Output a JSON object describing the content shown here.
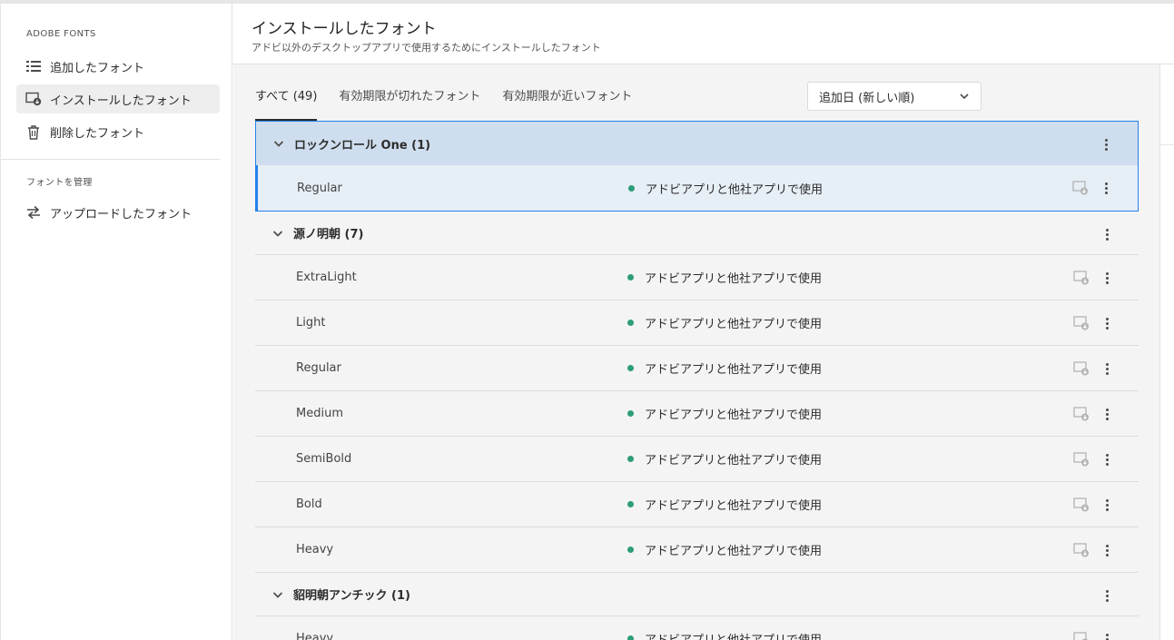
{
  "sidebar": {
    "section_fonts": "ADOBE FONTS",
    "items": [
      {
        "label": "追加したフォント",
        "icon": "list-icon"
      },
      {
        "label": "インストールしたフォント",
        "icon": "install-icon"
      },
      {
        "label": "削除したフォント",
        "icon": "trash-icon"
      }
    ],
    "section_manage": "フォントを管理",
    "manage_items": [
      {
        "label": "アップロードしたフォント",
        "icon": "upload-arrows-icon"
      }
    ]
  },
  "header": {
    "title": "インストールしたフォント",
    "subtitle": "アドビ以外のデスクトップアプリで使用するためにインストールしたフォント"
  },
  "tabs": [
    {
      "label": "すべて (49)",
      "active": true
    },
    {
      "label": "有効期限が切れたフォント",
      "active": false
    },
    {
      "label": "有効期限が近いフォント",
      "active": false
    }
  ],
  "sort": {
    "value": "追加日 (新しい順)"
  },
  "groups": [
    {
      "name": "ロックンロール One (1)",
      "selected": true,
      "styles": [
        {
          "name": "Regular",
          "status": "アドビアプリと他社アプリで使用"
        }
      ]
    },
    {
      "name": "源ノ明朝 (7)",
      "selected": false,
      "styles": [
        {
          "name": "ExtraLight",
          "status": "アドビアプリと他社アプリで使用"
        },
        {
          "name": "Light",
          "status": "アドビアプリと他社アプリで使用"
        },
        {
          "name": "Regular",
          "status": "アドビアプリと他社アプリで使用"
        },
        {
          "name": "Medium",
          "status": "アドビアプリと他社アプリで使用"
        },
        {
          "name": "SemiBold",
          "status": "アドビアプリと他社アプリで使用"
        },
        {
          "name": "Bold",
          "status": "アドビアプリと他社アプリで使用"
        },
        {
          "name": "Heavy",
          "status": "アドビアプリと他社アプリで使用"
        }
      ]
    },
    {
      "name": "貂明朝アンチック (1)",
      "selected": false,
      "styles": [
        {
          "name": "Heavy",
          "status": "アドビアプリと他社アプリで使用"
        }
      ]
    }
  ],
  "colors": {
    "status_dot": "#2d9d78",
    "selection_border": "#2680eb",
    "selected_header_bg": "#cfdeee",
    "selected_row_bg": "#e6eef6"
  }
}
